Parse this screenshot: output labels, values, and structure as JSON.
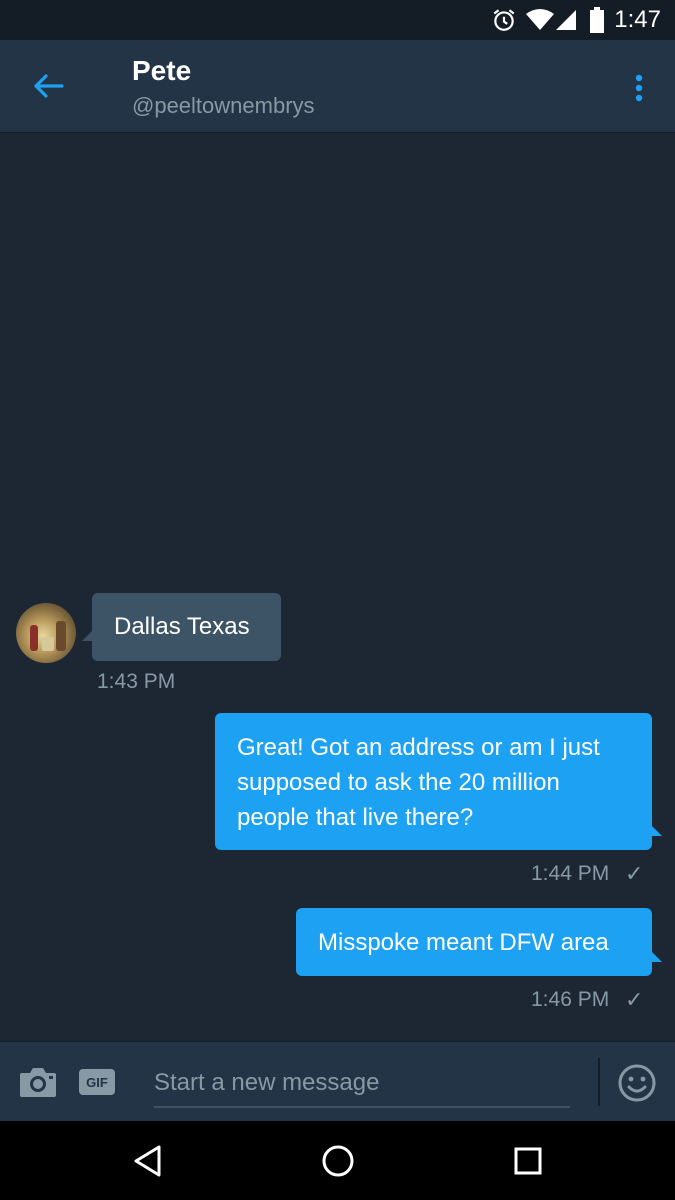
{
  "status_bar": {
    "time": "1:47"
  },
  "header": {
    "name": "Pete",
    "handle": "@peeltownembrys"
  },
  "messages": [
    {
      "direction": "incoming",
      "text": "Dallas Texas",
      "time": "1:43 PM"
    },
    {
      "direction": "outgoing",
      "text": "Great! Got an address or am I just supposed to ask the 20 million people that live there?",
      "time": "1:44 PM",
      "status": "✓"
    },
    {
      "direction": "outgoing",
      "text": "Misspoke meant DFW area",
      "time": "1:46 PM",
      "status": "✓"
    }
  ],
  "composer": {
    "gif_label": "GIF",
    "placeholder": "Start a new message"
  },
  "colors": {
    "background": "#1c2733",
    "header": "#243447",
    "accent": "#1da1f2",
    "incoming_bubble": "#3d5466",
    "muted_text": "#8899a6"
  },
  "icons": [
    "alarm-icon",
    "wifi-icon",
    "cell-signal-icon",
    "battery-icon",
    "back-arrow-icon",
    "more-vert-icon",
    "camera-icon",
    "emoji-icon",
    "back-triangle-icon",
    "home-circle-icon",
    "recents-square-icon"
  ]
}
